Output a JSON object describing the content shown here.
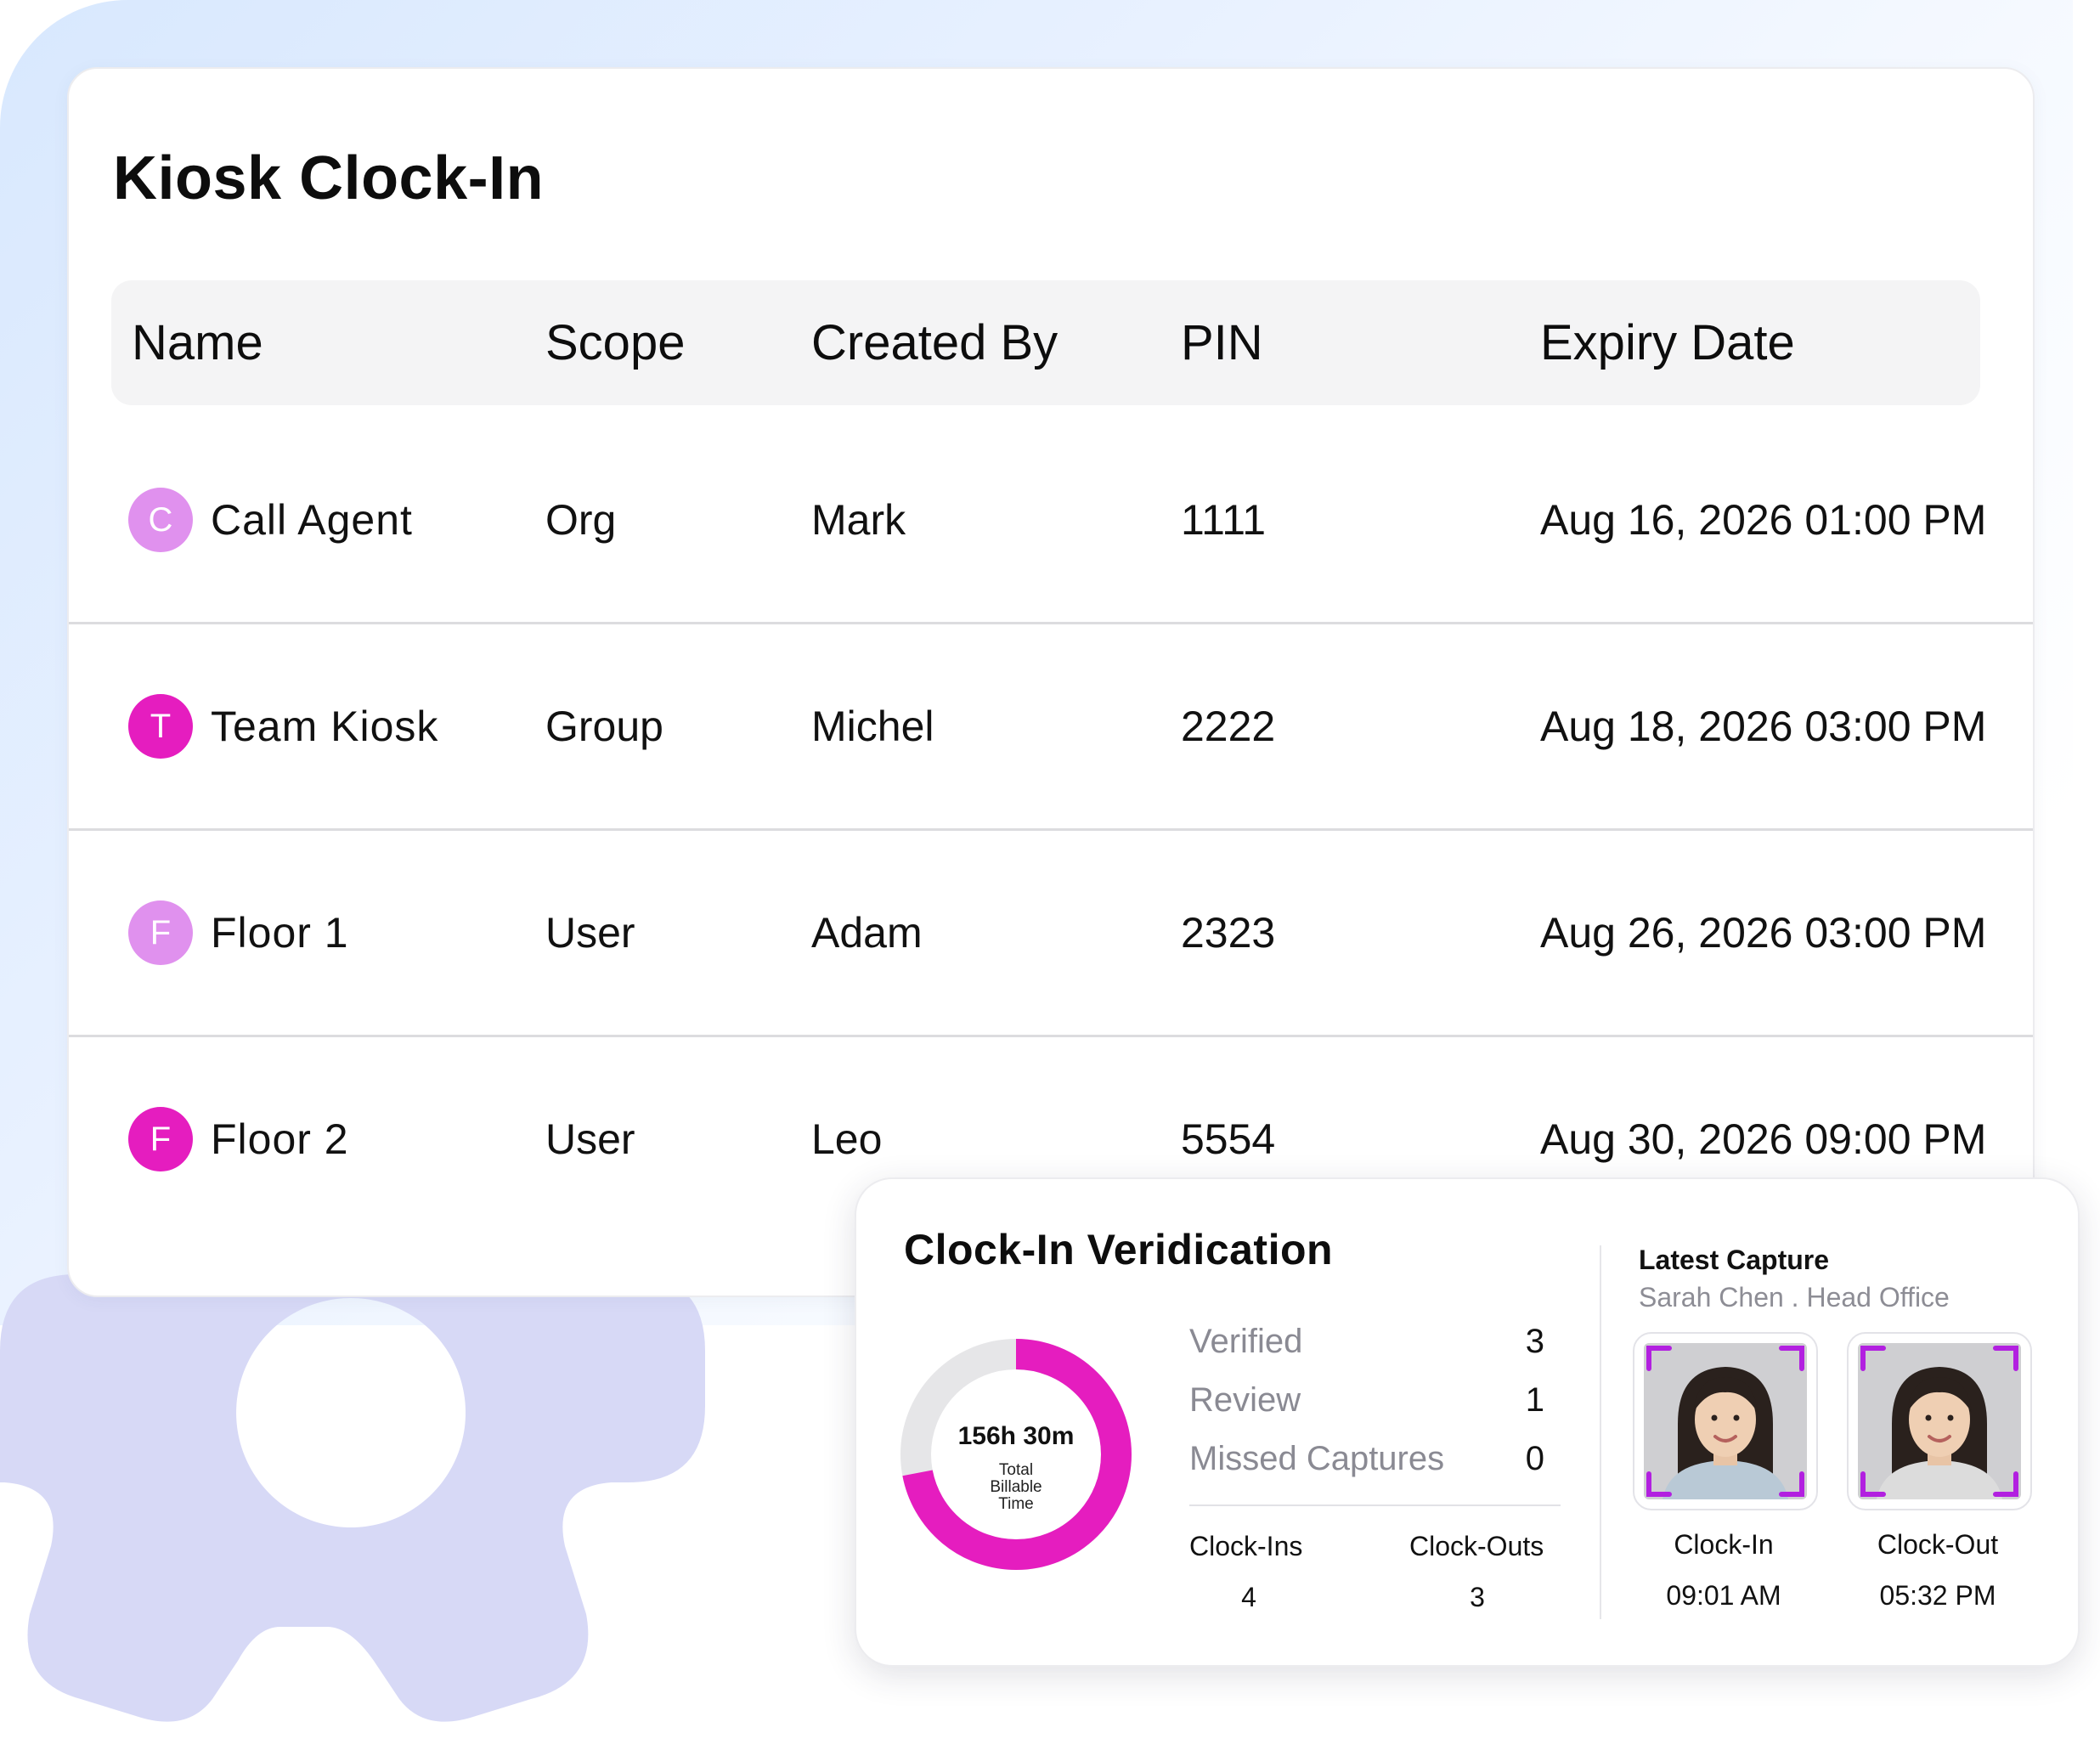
{
  "page": {
    "title": "Kiosk Clock-In"
  },
  "table": {
    "columns": [
      "Name",
      "Scope",
      "Created By",
      "PIN",
      "Expiry Date"
    ],
    "rows": [
      {
        "initial": "C",
        "name": "Call Agent",
        "scope": "Org",
        "created_by": "Mark",
        "pin": "1111",
        "expiry": "Aug 16, 2026 01:00 PM"
      },
      {
        "initial": "T",
        "name": "Team Kiosk",
        "scope": "Group",
        "created_by": "Michel",
        "pin": "2222",
        "expiry": "Aug 18, 2026 03:00 PM"
      },
      {
        "initial": "F",
        "name": "Floor 1",
        "scope": "User",
        "created_by": "Adam",
        "pin": "2323",
        "expiry": "Aug 26, 2026 03:00 PM"
      },
      {
        "initial": "F",
        "name": "Floor 2",
        "scope": "User",
        "created_by": "Leo",
        "pin": "5554",
        "expiry": "Aug 30, 2026 09:00 PM"
      }
    ]
  },
  "verification": {
    "title": "Clock-In Veridication",
    "donut": {
      "value": "156h 30m",
      "label": "Total Billable Time",
      "filled_fraction": 0.72
    },
    "stats": [
      {
        "label": "Verified",
        "value": "3"
      },
      {
        "label": "Review",
        "value": "1"
      },
      {
        "label": "Missed Captures",
        "value": "0"
      }
    ],
    "clock_ins": {
      "label": "Clock-Ins",
      "value": "4"
    },
    "clock_outs": {
      "label": "Clock-Outs",
      "value": "3"
    },
    "latest_capture": {
      "title": "Latest Capture",
      "subtitle": "Sarah Chen . Head Office",
      "clock_in": {
        "label": "Clock-In",
        "time": "09:01 AM"
      },
      "clock_out": {
        "label": "Clock-Out",
        "time": "05:32 PM"
      }
    }
  },
  "colors": {
    "accent": "#e51dbf",
    "accent_light": "#e091ee",
    "donut_track": "#e6e6e8",
    "gear": "#d7d9f6"
  }
}
